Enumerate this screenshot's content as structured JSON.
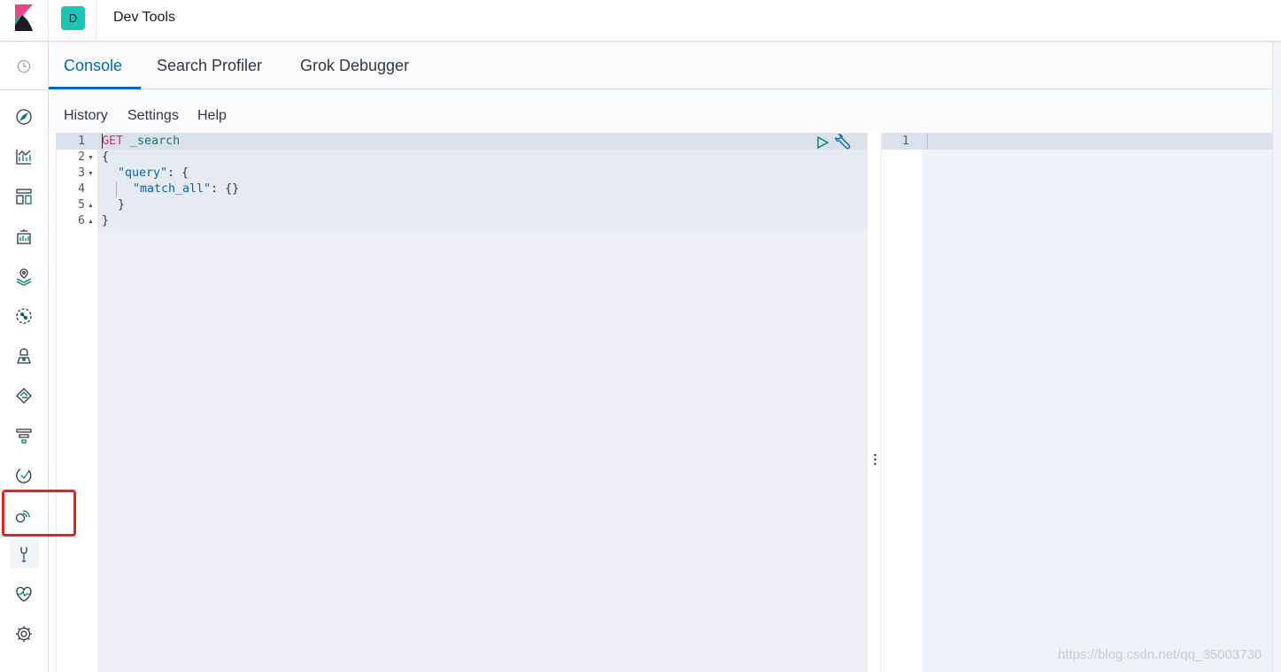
{
  "header": {
    "space_initial": "D",
    "app_title": "Dev Tools"
  },
  "sidebar": {
    "items": [
      {
        "icon": "clock-icon",
        "label": "Recently viewed"
      },
      {
        "icon": "discover-compass-icon",
        "label": "Discover"
      },
      {
        "icon": "visualize-chart-icon",
        "label": "Visualize"
      },
      {
        "icon": "dashboard-icon",
        "label": "Dashboard"
      },
      {
        "icon": "canvas-icon",
        "label": "Canvas"
      },
      {
        "icon": "maps-icon",
        "label": "Maps"
      },
      {
        "icon": "machine-learning-icon",
        "label": "Machine Learning"
      },
      {
        "icon": "infrastructure-icon",
        "label": "Infrastructure"
      },
      {
        "icon": "logs-icon",
        "label": "Logs"
      },
      {
        "icon": "apm-icon",
        "label": "APM"
      },
      {
        "icon": "uptime-icon",
        "label": "Uptime"
      },
      {
        "icon": "siem-icon",
        "label": "SIEM"
      },
      {
        "icon": "dev-tools-wrench-icon",
        "label": "Dev Tools"
      },
      {
        "icon": "monitoring-heartbeat-icon",
        "label": "Stack Monitoring"
      },
      {
        "icon": "management-gear-icon",
        "label": "Management"
      }
    ],
    "active": "Dev Tools",
    "highlight_color": "#e8211b"
  },
  "tabs": [
    {
      "label": "Console",
      "active": true
    },
    {
      "label": "Search Profiler",
      "active": false
    },
    {
      "label": "Grok Debugger",
      "active": false
    }
  ],
  "console_menu": {
    "history": "History",
    "settings": "Settings",
    "help": "Help"
  },
  "editor": {
    "line_numbers": [
      "1",
      "2",
      "3",
      "4",
      "5",
      "6"
    ],
    "lines": [
      {
        "method": "GET",
        "url": "_search"
      },
      {
        "text": "{"
      },
      {
        "key": "\"query\"",
        "rest": ": {"
      },
      {
        "key": "\"match_all\"",
        "rest": ": {}"
      },
      {
        "text": "}"
      },
      {
        "text": "}"
      }
    ],
    "actions": {
      "run": "play-icon",
      "tools": "wrench-icon"
    }
  },
  "output": {
    "line_numbers": [
      "1"
    ]
  },
  "watermark": "https://blog.csdn.net/qq_35003730",
  "colors": {
    "accent": "#006bb4",
    "space_avatar": "#1dc3b4",
    "method": "#c23a6d",
    "url": "#1d7478",
    "key": "#0b64a6"
  }
}
